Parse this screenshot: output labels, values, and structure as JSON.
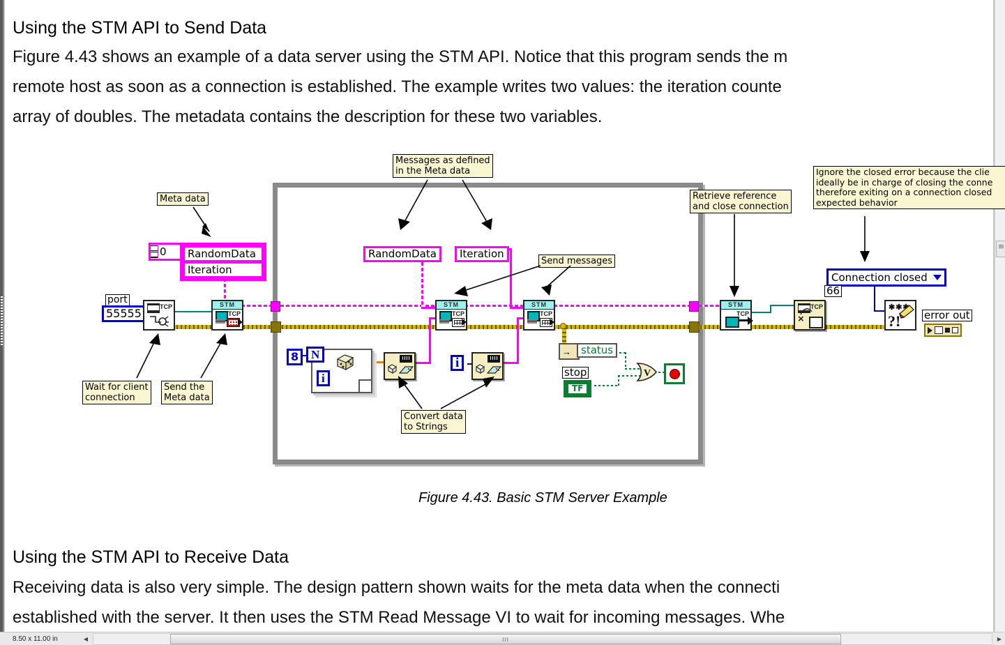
{
  "document": {
    "heading_1": "Using the STM API to Send Data",
    "paragraph_1": [
      "Figure 4.43 shows an example of a data server using the STM API. Notice that this program sends the m",
      "remote host as soon as a connection is established. The example writes two values: the iteration counte",
      "array of doubles. The metadata contains the description for these two variables."
    ],
    "figure_caption": "Figure 4.43. Basic STM Server Example",
    "heading_2": "Using the STM API to Receive Data",
    "paragraph_2": [
      "Receiving data is also very simple. The design pattern shown waits for the meta data when the connecti",
      "established with the server. It then uses the STM Read Message VI to wait for incoming messages. Whe"
    ]
  },
  "statusbar": {
    "page_dimensions": "8.50 x 11.00 in",
    "scroll_left_arrow": "◀",
    "scroll_right_arrow": "▶",
    "thumb_grip": "III"
  },
  "diagram": {
    "title": "Basic STM Server Example LabVIEW block diagram",
    "notes": {
      "meta_data": "Meta data",
      "messages_as_defined": "Messages as defined\nin the Meta data",
      "send_messages": "Send messages",
      "retrieve_reference": "Retrieve reference\nand close connection",
      "ignore_closed_error": "Ignore the closed error because the clie\nideally be in charge of closing the conne\ntherefore exiting on a connection closed\nexpected behavior",
      "wait_for_client": "Wait for client\nconnection",
      "send_the_meta_data": "Send the\nMeta data",
      "convert_data": "Convert data\nto Strings"
    },
    "controls": {
      "port_label": "port",
      "port_value": "55555",
      "index_value": "0",
      "meta_row_1": "RandomData",
      "meta_row_2": "Iteration",
      "random_data_const": "RandomData",
      "iteration_const": "Iteration",
      "loop_count_value": "8",
      "loop_n_terminal": "N",
      "loop_i_terminal": "i",
      "second_i_terminal": "i",
      "status_label": "status",
      "stop_label": "stop",
      "stop_value": "TF",
      "error_code_enum": "Connection closed",
      "error_code_value": "66",
      "error_out_label": "error out"
    },
    "nodes": {
      "tcp_listen": "TCP",
      "stm_write_meta": "STM",
      "stm_write_1": "STM",
      "stm_write_2": "STM",
      "stm_close_ref": "STM",
      "tcp_close": "TCP",
      "clear_error": "?!",
      "or_gate": "V"
    },
    "colors": {
      "magenta_wire": "#ff00ff",
      "yellow_error_wire": "#d6b800",
      "teal_refnum_wire": "#00807f",
      "blue_numeric": "#0000cc",
      "green_boolean": "#0a7d32",
      "orange_double": "#ff7f00",
      "note_background": "#fbf6d2",
      "loop_border": "#8a8a8a"
    }
  }
}
